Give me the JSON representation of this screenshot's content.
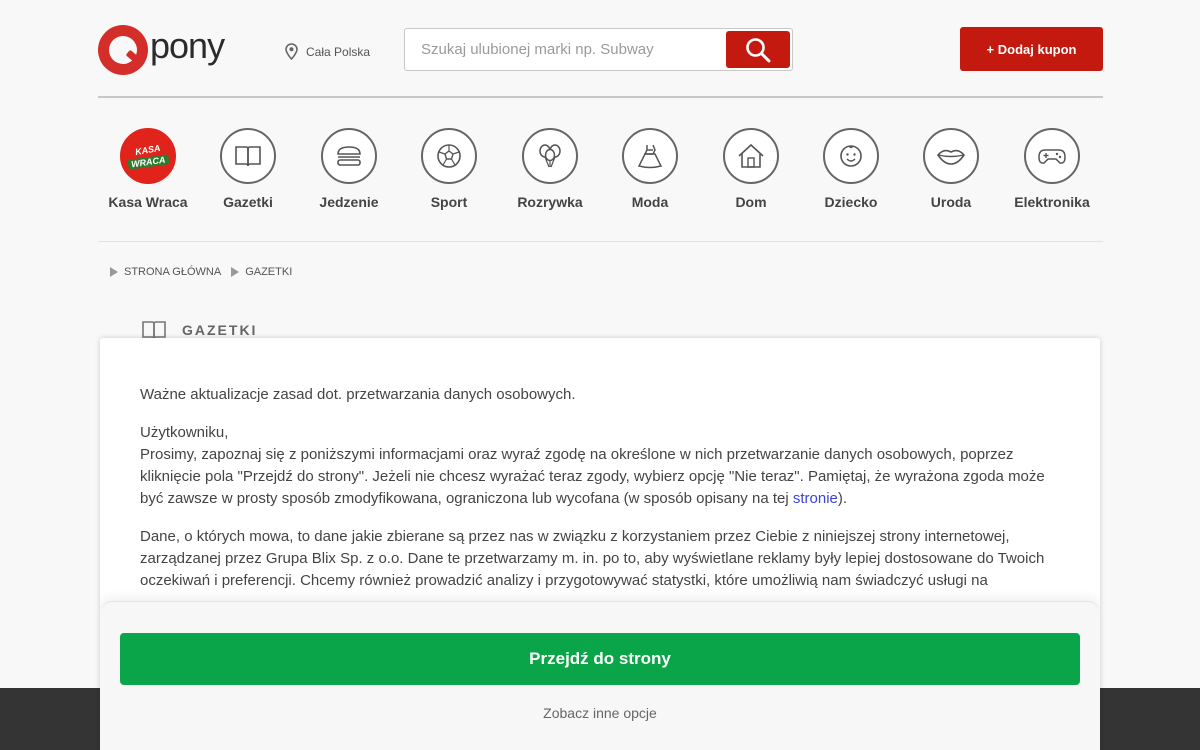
{
  "header": {
    "logo_text": "pony",
    "location": "Cała Polska",
    "search_placeholder": "Szukaj ulubionej marki np. Subway",
    "add_coupon_label": "+ Dodaj kupon"
  },
  "categories": [
    {
      "label": "Kasa Wraca",
      "icon": "kasa-wraca-logo",
      "badge_top": "KASA",
      "badge_bottom": "WRACA"
    },
    {
      "label": "Gazetki",
      "icon": "book-icon"
    },
    {
      "label": "Jedzenie",
      "icon": "burger-icon"
    },
    {
      "label": "Sport",
      "icon": "ball-icon"
    },
    {
      "label": "Rozrywka",
      "icon": "balloons-icon"
    },
    {
      "label": "Moda",
      "icon": "dress-icon"
    },
    {
      "label": "Dom",
      "icon": "house-icon"
    },
    {
      "label": "Dziecko",
      "icon": "baby-icon"
    },
    {
      "label": "Uroda",
      "icon": "lips-icon"
    },
    {
      "label": "Elektronika",
      "icon": "gamepad-icon"
    }
  ],
  "breadcrumb": [
    "STRONA GŁÓWNA",
    "GAZETKI"
  ],
  "section_title": "GAZETKI",
  "modal": {
    "p1": "Ważne aktualizacje zasad dot. przetwarzania danych osobowych.",
    "p2_line1": "Użytkowniku,",
    "p2_text": "Prosimy, zapoznaj się z poniższymi informacjami oraz wyraź zgodę na określone w nich przetwarzanie danych osobowych, poprzez kliknięcie pola \"Przejdź do strony\". Jeżeli nie chcesz wyrażać teraz zgody, wybierz opcję \"Nie teraz\". Pamiętaj, że wyrażona zgoda może być zawsze w prosty sposób zmodyfikowana, ograniczona lub wycofana (w sposób opisany na tej ",
    "p2_link": "stronie",
    "p2_end": ").",
    "p3": "Dane, o których mowa, to dane jakie zbierane są przez nas w związku z korzystaniem przez Ciebie z niniejszej strony internetowej, zarządzanej przez Grupa Blix Sp. z o.o. Dane te przetwarzamy m. in. po to, aby wyświetlane reklamy były lepiej dostosowane do Twoich oczekiwań i preferencji. Chcemy również prowadzić analizy i przygotowywać statystki, które umożliwią nam świadczyć usługi na",
    "go_button": "Przejdź do strony",
    "other_options": "Zobacz inne opcje"
  },
  "colors": {
    "brand_red": "#c4190f",
    "accept_green": "#0aa548",
    "link_blue": "#3b44d8"
  }
}
